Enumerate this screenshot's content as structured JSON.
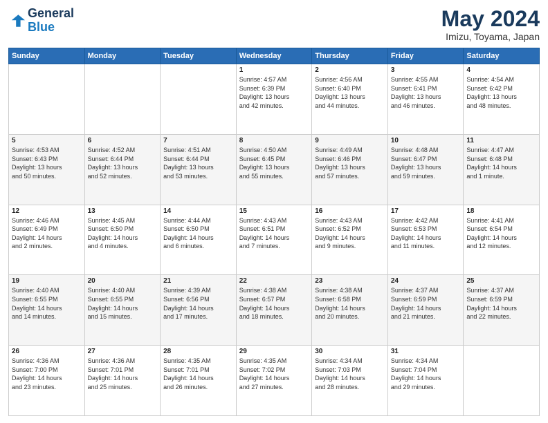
{
  "logo": {
    "line1": "General",
    "line2": "Blue"
  },
  "title": "May 2024",
  "subtitle": "Imizu, Toyama, Japan",
  "headers": [
    "Sunday",
    "Monday",
    "Tuesday",
    "Wednesday",
    "Thursday",
    "Friday",
    "Saturday"
  ],
  "weeks": [
    [
      {
        "day": "",
        "info": ""
      },
      {
        "day": "",
        "info": ""
      },
      {
        "day": "",
        "info": ""
      },
      {
        "day": "1",
        "info": "Sunrise: 4:57 AM\nSunset: 6:39 PM\nDaylight: 13 hours\nand 42 minutes."
      },
      {
        "day": "2",
        "info": "Sunrise: 4:56 AM\nSunset: 6:40 PM\nDaylight: 13 hours\nand 44 minutes."
      },
      {
        "day": "3",
        "info": "Sunrise: 4:55 AM\nSunset: 6:41 PM\nDaylight: 13 hours\nand 46 minutes."
      },
      {
        "day": "4",
        "info": "Sunrise: 4:54 AM\nSunset: 6:42 PM\nDaylight: 13 hours\nand 48 minutes."
      }
    ],
    [
      {
        "day": "5",
        "info": "Sunrise: 4:53 AM\nSunset: 6:43 PM\nDaylight: 13 hours\nand 50 minutes."
      },
      {
        "day": "6",
        "info": "Sunrise: 4:52 AM\nSunset: 6:44 PM\nDaylight: 13 hours\nand 52 minutes."
      },
      {
        "day": "7",
        "info": "Sunrise: 4:51 AM\nSunset: 6:44 PM\nDaylight: 13 hours\nand 53 minutes."
      },
      {
        "day": "8",
        "info": "Sunrise: 4:50 AM\nSunset: 6:45 PM\nDaylight: 13 hours\nand 55 minutes."
      },
      {
        "day": "9",
        "info": "Sunrise: 4:49 AM\nSunset: 6:46 PM\nDaylight: 13 hours\nand 57 minutes."
      },
      {
        "day": "10",
        "info": "Sunrise: 4:48 AM\nSunset: 6:47 PM\nDaylight: 13 hours\nand 59 minutes."
      },
      {
        "day": "11",
        "info": "Sunrise: 4:47 AM\nSunset: 6:48 PM\nDaylight: 14 hours\nand 1 minute."
      }
    ],
    [
      {
        "day": "12",
        "info": "Sunrise: 4:46 AM\nSunset: 6:49 PM\nDaylight: 14 hours\nand 2 minutes."
      },
      {
        "day": "13",
        "info": "Sunrise: 4:45 AM\nSunset: 6:50 PM\nDaylight: 14 hours\nand 4 minutes."
      },
      {
        "day": "14",
        "info": "Sunrise: 4:44 AM\nSunset: 6:50 PM\nDaylight: 14 hours\nand 6 minutes."
      },
      {
        "day": "15",
        "info": "Sunrise: 4:43 AM\nSunset: 6:51 PM\nDaylight: 14 hours\nand 7 minutes."
      },
      {
        "day": "16",
        "info": "Sunrise: 4:43 AM\nSunset: 6:52 PM\nDaylight: 14 hours\nand 9 minutes."
      },
      {
        "day": "17",
        "info": "Sunrise: 4:42 AM\nSunset: 6:53 PM\nDaylight: 14 hours\nand 11 minutes."
      },
      {
        "day": "18",
        "info": "Sunrise: 4:41 AM\nSunset: 6:54 PM\nDaylight: 14 hours\nand 12 minutes."
      }
    ],
    [
      {
        "day": "19",
        "info": "Sunrise: 4:40 AM\nSunset: 6:55 PM\nDaylight: 14 hours\nand 14 minutes."
      },
      {
        "day": "20",
        "info": "Sunrise: 4:40 AM\nSunset: 6:55 PM\nDaylight: 14 hours\nand 15 minutes."
      },
      {
        "day": "21",
        "info": "Sunrise: 4:39 AM\nSunset: 6:56 PM\nDaylight: 14 hours\nand 17 minutes."
      },
      {
        "day": "22",
        "info": "Sunrise: 4:38 AM\nSunset: 6:57 PM\nDaylight: 14 hours\nand 18 minutes."
      },
      {
        "day": "23",
        "info": "Sunrise: 4:38 AM\nSunset: 6:58 PM\nDaylight: 14 hours\nand 20 minutes."
      },
      {
        "day": "24",
        "info": "Sunrise: 4:37 AM\nSunset: 6:59 PM\nDaylight: 14 hours\nand 21 minutes."
      },
      {
        "day": "25",
        "info": "Sunrise: 4:37 AM\nSunset: 6:59 PM\nDaylight: 14 hours\nand 22 minutes."
      }
    ],
    [
      {
        "day": "26",
        "info": "Sunrise: 4:36 AM\nSunset: 7:00 PM\nDaylight: 14 hours\nand 23 minutes."
      },
      {
        "day": "27",
        "info": "Sunrise: 4:36 AM\nSunset: 7:01 PM\nDaylight: 14 hours\nand 25 minutes."
      },
      {
        "day": "28",
        "info": "Sunrise: 4:35 AM\nSunset: 7:01 PM\nDaylight: 14 hours\nand 26 minutes."
      },
      {
        "day": "29",
        "info": "Sunrise: 4:35 AM\nSunset: 7:02 PM\nDaylight: 14 hours\nand 27 minutes."
      },
      {
        "day": "30",
        "info": "Sunrise: 4:34 AM\nSunset: 7:03 PM\nDaylight: 14 hours\nand 28 minutes."
      },
      {
        "day": "31",
        "info": "Sunrise: 4:34 AM\nSunset: 7:04 PM\nDaylight: 14 hours\nand 29 minutes."
      },
      {
        "day": "",
        "info": ""
      }
    ]
  ]
}
